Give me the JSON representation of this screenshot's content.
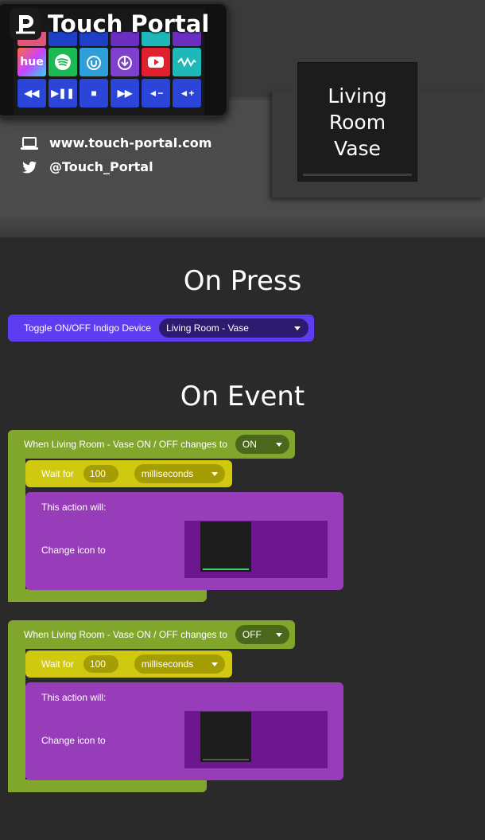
{
  "header": {
    "brand_name": "Touch Portal",
    "brand_logo_letter": "P",
    "website": "www.touch-portal.com",
    "twitter": "@Touch_Portal",
    "website_icon": "laptop-icon",
    "twitter_icon": "twitter-icon"
  },
  "phone_tiles": {
    "row1": [
      {
        "label": "hue",
        "color": "#e0567a"
      },
      {
        "label": "Spotify",
        "color": "#1db954"
      },
      {
        "label": "U",
        "color": "#2e9fd8"
      },
      {
        "label": "Power",
        "color": "#7f3fcf"
      },
      {
        "label": "YouTube",
        "color": "#e0202f"
      },
      {
        "label": "Wave",
        "color": "#1fb8b8"
      }
    ],
    "row2": [
      {
        "label": "Rewind",
        "color": "#2a45d8"
      },
      {
        "label": "Play/Pause",
        "color": "#2a45d8"
      },
      {
        "label": "Stop",
        "color": "#2a45d8"
      },
      {
        "label": "Fast Forward",
        "color": "#2a45d8"
      },
      {
        "label": "Volume Down",
        "color": "#2a45d8"
      },
      {
        "label": "Volume Up",
        "color": "#2a45d8"
      }
    ]
  },
  "button_preview": {
    "label": "Living\nRoom\nVase"
  },
  "on_press": {
    "title": "On Press",
    "action_label": "Toggle ON/OFF Indigo Device",
    "device_value": "Living Room - Vase",
    "color": "#5e3df1"
  },
  "on_event": {
    "title": "On Event",
    "events": [
      {
        "condition_label": "When Living Room - Vase ON / OFF changes to",
        "state_value": "ON",
        "wait_label": "Wait for",
        "wait_amount": "100",
        "wait_unit": "milliseconds",
        "action_will_label": "This action will:",
        "change_icon_label": "Change icon to",
        "icon_bar_color": "#3bd16f"
      },
      {
        "condition_label": "When Living Room - Vase ON / OFF changes to",
        "state_value": "OFF",
        "wait_label": "Wait for",
        "wait_amount": "100",
        "wait_unit": "milliseconds",
        "action_will_label": "This action will:",
        "change_icon_label": "Change icon to",
        "icon_bar_color": "#555555"
      }
    ]
  }
}
